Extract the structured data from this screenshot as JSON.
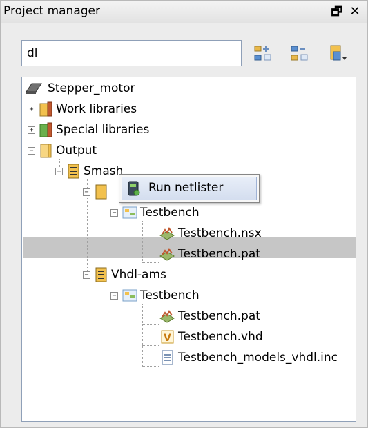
{
  "panel": {
    "title": "Project manager",
    "pin_glyph": "🗗",
    "close_glyph": "✕"
  },
  "search": {
    "value": "dl",
    "placeholder": ""
  },
  "toolbar": {
    "buttons": [
      "expand-all-icon",
      "collapse-all-icon",
      "filter-dropdown-icon"
    ]
  },
  "tree": {
    "root": "Stepper_motor",
    "work_libraries": "Work libraries",
    "special_libraries": "Special libraries",
    "output": "Output",
    "smash": "Smash",
    "smash_testbench": "Testbench",
    "smash_nsx": "Testbench.nsx",
    "smash_pat": "Testbench.pat",
    "vhdl_ams": "Vhdl-ams",
    "vhdl_testbench": "Testbench",
    "vhdl_pat": "Testbench.pat",
    "vhdl_vhd": "Testbench.vhd",
    "vhdl_inc": "Testbench_models_vhdl.inc"
  },
  "context_menu": {
    "run_netlister": "Run netlister"
  },
  "colors": {
    "selection": "#c6c6c6",
    "menu_highlight": "#d4deef",
    "folder": "#f2c14e"
  }
}
